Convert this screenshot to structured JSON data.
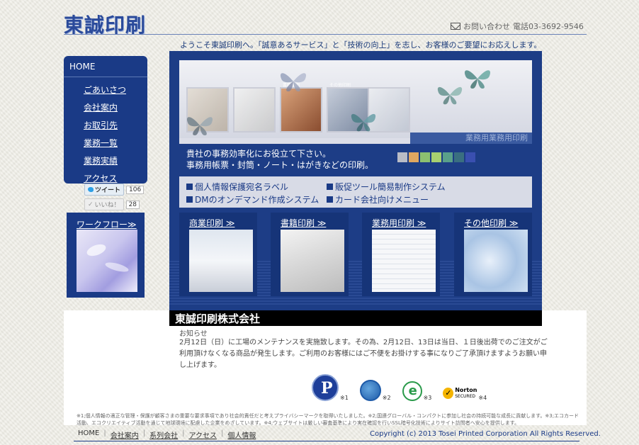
{
  "header": {
    "logo": "東誠印刷",
    "contact_label": "お問い合わせ",
    "phone": "電話03-3692-9546",
    "welcome": "ようこそ東誠印刷へ。「誠意あるサービス」と「技術の向上」を志し、お客様のご要望にお応えします。"
  },
  "nav": {
    "home": "HOME",
    "items": [
      {
        "label": "ごあいさつ"
      },
      {
        "label": "会社案内"
      },
      {
        "label": "お取引先"
      },
      {
        "label": "業務一覧"
      },
      {
        "label": "業務実績"
      },
      {
        "label": "アクセス"
      }
    ]
  },
  "social": {
    "tweet_label": "ツイート",
    "tweet_count": "106",
    "like_label": "いいね！",
    "like_count": "28"
  },
  "workflow": {
    "label": "ワークフロー≫"
  },
  "hero": {
    "tag": "業務用業務用印刷",
    "copy_line1": "貴社の事務効率化にお役立て下さい。",
    "copy_line2": "事務用帳票・封筒・ノート・はがきなどの印刷。",
    "features": [
      {
        "label": "個人情報保護宛名ラベル"
      },
      {
        "label": "販促ツール簡易制作システム"
      },
      {
        "label": "DMのオンデマンド作成システム"
      },
      {
        "label": "カード会社向けメニュー"
      }
    ],
    "thumb_labels": [
      "書籍印刷",
      "その他印刷"
    ],
    "swatches": [
      "#b9bcc6",
      "#e0a760",
      "#8cc070",
      "#a8d070",
      "#5aa08a",
      "#3a6f80",
      "#3a4fb0"
    ]
  },
  "categories": [
    {
      "label": "商業印刷 ≫"
    },
    {
      "label": "書籍印刷 ≫"
    },
    {
      "label": "業務用印刷 ≫"
    },
    {
      "label": "その他印刷 ≫"
    }
  ],
  "company": {
    "name": "東誠印刷株式会社"
  },
  "notice": {
    "title": "お知らせ",
    "body": "2月12日（日）に工場のメンテナンスを実施致します。その為、2月12日、13日は当日、１日後出荷でのご注文がご利用頂けなくなる商品が発生します。ご利用のお客様にはご不便をお掛けする事になりご了承頂けますようお願い申し上げます。"
  },
  "badges": {
    "note1": "※1",
    "note2": "※2",
    "note3": "※3",
    "note4": "※4",
    "norton_text": "Norton",
    "norton_sub": "SECURED"
  },
  "footnote": "※1;個人情報の適正な管理・保護が顧客さまの重要な要求事項であり社会的責任だと考えプライバシーマークを取得いたしました。※2;国連グローバル・コンパクトに参加し社会の持続可能な成長に貢献します。※3;エコカード活動、エコクリエイティブ活動を通じて地球環境に配慮した企業をめざしています。※4;ウェブサイトは厳しい審査基準により実在確認を行いSSL暗号化技術によりサイト訪問者へ安心を提供します。",
  "footer": {
    "links": [
      {
        "label": "HOME"
      },
      {
        "label": "会社案内"
      },
      {
        "label": "系列会社"
      },
      {
        "label": "アクセス"
      },
      {
        "label": "個人情報"
      }
    ],
    "copyright": "Copyright (c) 2013 Tosei Printed Corporation All Rights Reserved."
  }
}
